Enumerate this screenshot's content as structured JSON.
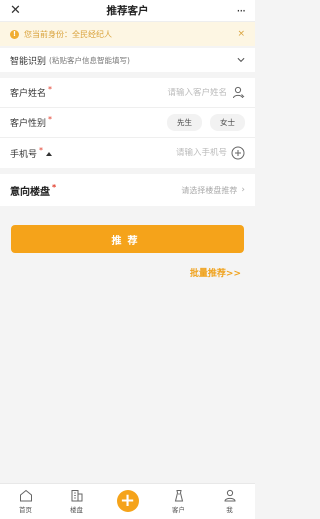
{
  "nav": {
    "close_icon": "close-icon",
    "title": "推荐客户",
    "more_icon": "more-icon",
    "more_glyph": "···"
  },
  "notice": {
    "text": "您当前身份：全民经纪人",
    "close": "×",
    "accent": "#d9a23b"
  },
  "smart": {
    "label": "智能识别",
    "hint": "(粘贴客户信息智能填写)"
  },
  "form": {
    "name": {
      "label": "客户姓名",
      "required": "*",
      "placeholder": "请输入客户姓名"
    },
    "gender": {
      "label": "客户性别",
      "required": "*",
      "options": [
        "先生",
        "女士"
      ]
    },
    "phone": {
      "label": "手机号",
      "required": "*",
      "placeholder": "请输入手机号"
    },
    "property": {
      "label": "意向楼盘",
      "required": "*",
      "placeholder": "请选择楼盘推荐",
      "chevron": "›"
    }
  },
  "actions": {
    "submit": "推荐",
    "batch": "批量推荐>>"
  },
  "tabs": [
    {
      "label": "首页",
      "icon": "home-icon"
    },
    {
      "label": "楼盘",
      "icon": "building-icon"
    },
    {
      "label": "",
      "icon": "plus-icon",
      "glyph": "+"
    },
    {
      "label": "客户",
      "icon": "customer-icon"
    },
    {
      "label": "我",
      "icon": "user-icon"
    }
  ],
  "colors": {
    "accent": "#f5a31a",
    "required": "#e23c2a"
  }
}
